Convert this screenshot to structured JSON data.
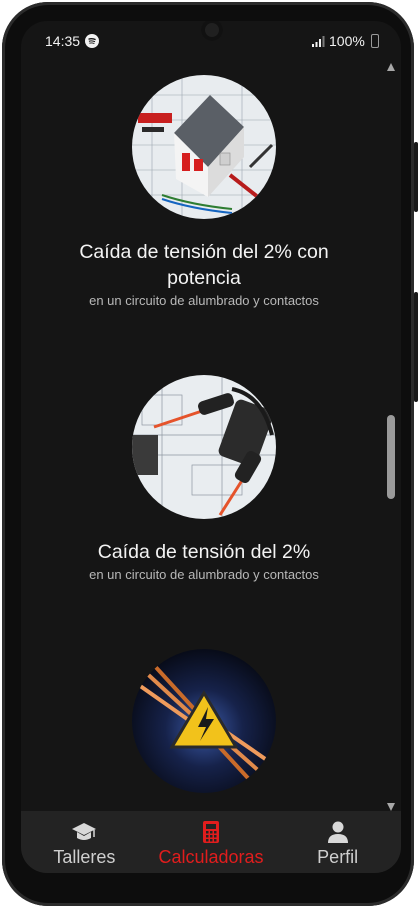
{
  "status": {
    "time": "14:35",
    "battery": "100%"
  },
  "cards": [
    {
      "title": "Caída de tensión del 2% con potencia",
      "subtitle": "en un circuito de alumbrado y contactos",
      "image": "house-and-tools-photo"
    },
    {
      "title": "Caída de tensión del 2%",
      "subtitle": "en un circuito de alumbrado y contactos",
      "image": "multimeter-probes-photo"
    },
    {
      "title": "",
      "subtitle": "",
      "image": "cables-warning-photo"
    }
  ],
  "nav": {
    "items": [
      {
        "label": "Talleres",
        "icon": "graduation-cap-icon"
      },
      {
        "label": "Calculadoras",
        "icon": "calculator-icon",
        "active": true
      },
      {
        "label": "Perfil",
        "icon": "user-icon"
      }
    ],
    "active_color": "#e11d1d"
  }
}
